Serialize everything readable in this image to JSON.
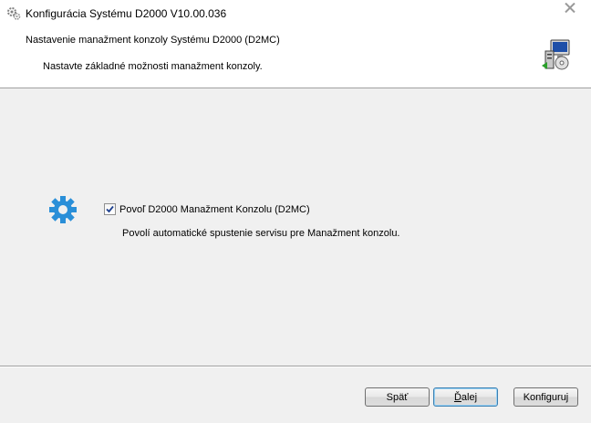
{
  "window": {
    "title": "Konfigurácia Systému D2000 V10.00.036",
    "icon": "gears-icon",
    "close_glyph": "✕"
  },
  "header": {
    "title": "Nastavenie manažment konzoly Systému D2000 (D2MC)",
    "subtitle": "Nastavte základné možnosti manažment konzoly.",
    "graphic": "computer-install-icon"
  },
  "main": {
    "icon": "gear-icon",
    "icon_color": "#2a8fd8",
    "checkbox": {
      "label": "Povoľ D2000 Manažment Konzolu (D2MC)",
      "checked": true
    },
    "description": "Povolí automatické spustenie servisu pre Manažment konzolu."
  },
  "buttons": {
    "back": "Späť",
    "next_underlined": "Ď",
    "next_rest": "alej",
    "configure": "Konfiguruj"
  }
}
